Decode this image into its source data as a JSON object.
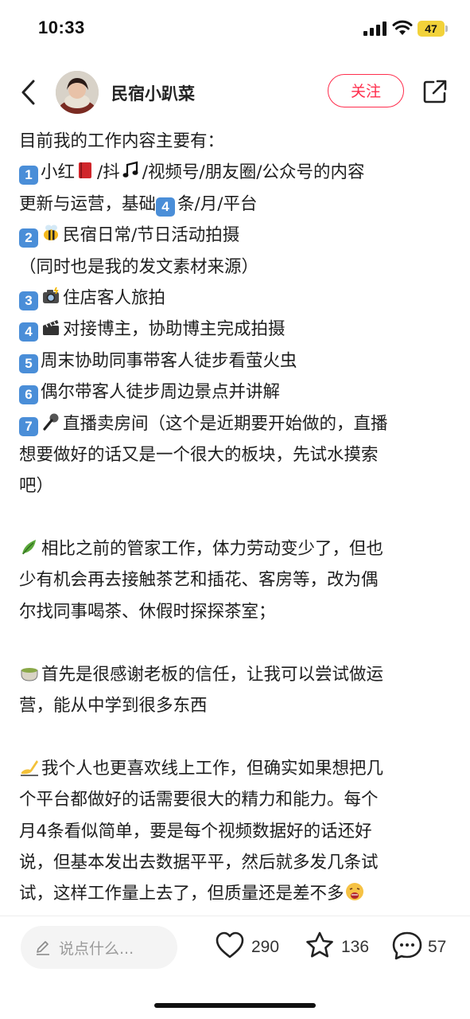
{
  "status_bar": {
    "time": "10:33",
    "battery": "47"
  },
  "header": {
    "author": "民宿小趴菜",
    "follow_label": "关注"
  },
  "post": {
    "intro": "目前我的工作内容主要有：",
    "items": [
      {
        "num": "1",
        "p1": "小红",
        "p2": "/抖",
        "p3": "/视频号/朋友圈/公众号的内容"
      },
      {
        "cont": "更新与运营，基础",
        "num": "4",
        "tail": "条/月/平台"
      },
      {
        "num": "2",
        "text": "民宿日常/节日活动拍摄"
      },
      {
        "cont": "（同时也是我的发文素材来源）"
      },
      {
        "num": "3",
        "text": "住店客人旅拍"
      },
      {
        "num": "4",
        "text": "对接博主，协助博主完成拍摄"
      },
      {
        "num": "5",
        "text": "周末协助同事带客人徒步看萤火虫"
      },
      {
        "num": "6",
        "text": "偶尔带客人徒步周边景点并讲解"
      },
      {
        "num": "7",
        "text": "直播卖房间（这个是近期要开始做的，直播"
      },
      {
        "cont": "想要做好的话又是一个很大的板块，先试水摸索"
      },
      {
        "cont": "吧）"
      }
    ],
    "para1": [
      "相比之前的管家工作，体力劳动变少了，但也",
      "少有机会再去接触茶艺和插花、客房等，改为偶",
      "尔找同事喝茶、休假时探探茶室；"
    ],
    "para2": [
      "首先是很感谢老板的信任，让我可以尝试做运",
      "营，能从中学到很多东西"
    ],
    "para3": [
      "我个人也更喜欢线上工作，但确实如果想把几",
      "个平台都做好的话需要很大的精力和能力。每个",
      "月4条看似简单，要是每个视频数据好的话还好",
      "说，但基本发出去数据平平，然后就多发几条试",
      "试，这样工作量上去了，但质量还是差不多"
    ]
  },
  "bottom_bar": {
    "comment_placeholder": "说点什么...",
    "likes": "290",
    "collects": "136",
    "comments": "57"
  },
  "icons": {
    "back": "chevron-left-icon",
    "share": "share-icon",
    "like": "heart-icon",
    "collect": "star-icon",
    "comment": "comment-bubble-icon",
    "emoji": [
      "book-emoji",
      "music-note-emoji",
      "bee-emoji",
      "camera-flash-emoji",
      "clapper-emoji",
      "microphone-emoji",
      "herb-emoji",
      "teacup-emoji",
      "writing-hand-emoji",
      "weary-face-emoji"
    ]
  },
  "colors": {
    "accent": "#ff2e4d",
    "keycap": "#4a8ed8",
    "battery": "#f2d23a"
  }
}
